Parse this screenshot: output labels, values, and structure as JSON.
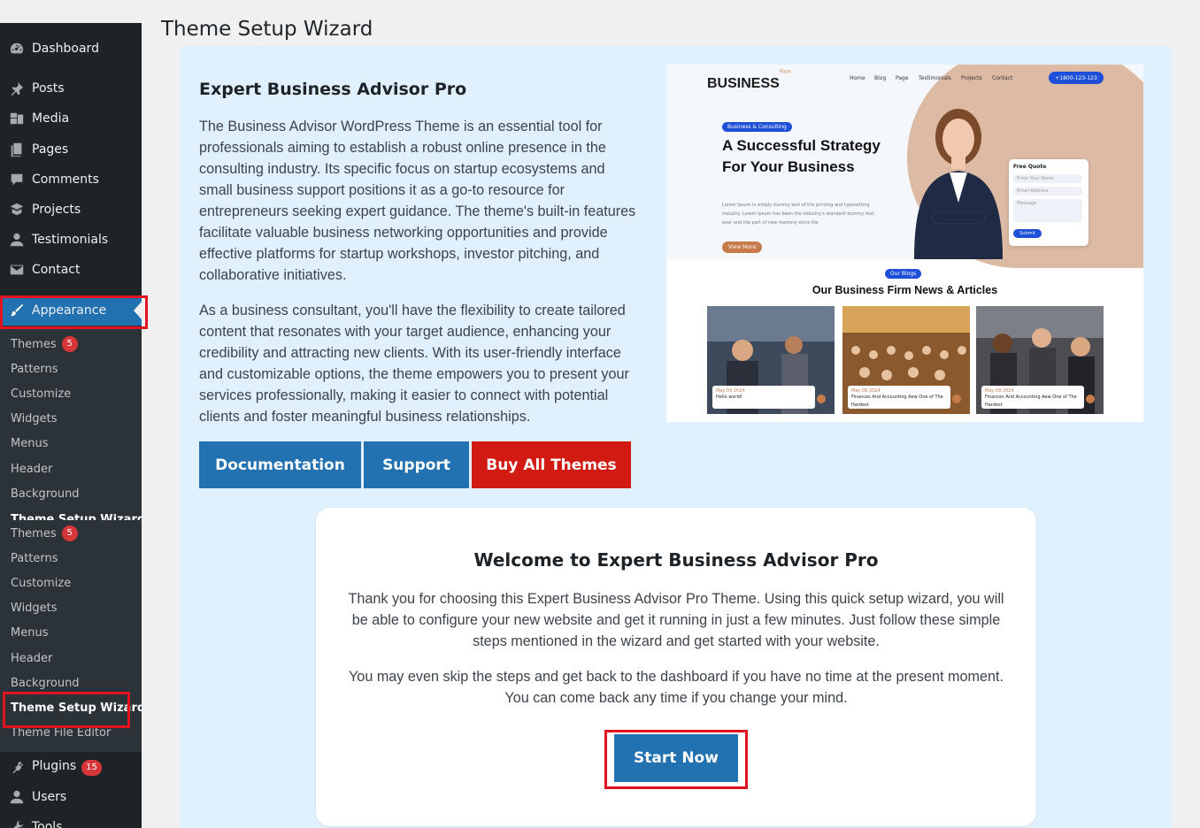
{
  "page": {
    "title": "Theme Setup Wizard"
  },
  "sidebar": {
    "top_items": [
      {
        "label": "Dashboard",
        "icon": "dashboard-icon"
      },
      {
        "label": "Posts",
        "icon": "pin-icon"
      },
      {
        "label": "Media",
        "icon": "media-icon"
      },
      {
        "label": "Pages",
        "icon": "pages-icon"
      },
      {
        "label": "Comments",
        "icon": "comment-icon"
      },
      {
        "label": "Projects",
        "icon": "portfolio-icon"
      },
      {
        "label": "Testimonials",
        "icon": "user-icon"
      },
      {
        "label": "Contact",
        "icon": "mail-icon"
      }
    ],
    "appearance": {
      "label": "Appearance",
      "icon": "paintbrush-icon"
    },
    "submenu": [
      {
        "label": "Themes",
        "badge": "5"
      },
      {
        "label": "Patterns"
      },
      {
        "label": "Customize"
      },
      {
        "label": "Widgets"
      },
      {
        "label": "Menus"
      },
      {
        "label": "Header"
      },
      {
        "label": "Background"
      },
      {
        "label": "Theme Setup Wizard"
      },
      {
        "label": "Themes",
        "badge": "5"
      },
      {
        "label": "Patterns"
      },
      {
        "label": "Customize"
      },
      {
        "label": "Widgets"
      },
      {
        "label": "Menus"
      },
      {
        "label": "Header"
      },
      {
        "label": "Background"
      },
      {
        "label": "Theme Setup Wizard"
      },
      {
        "label": "Theme File Editor"
      }
    ],
    "bottom_items": [
      {
        "label": "Plugins",
        "badge": "15",
        "icon": "plugin-icon"
      },
      {
        "label": "Users",
        "icon": "users-icon"
      },
      {
        "label": "Tools",
        "icon": "tools-icon"
      }
    ]
  },
  "intro": {
    "title": "Expert Business Advisor Pro",
    "paragraph1": "The Business Advisor WordPress Theme is an essential tool for professionals aiming to establish a robust online presence in the consulting industry. Its specific focus on startup ecosystems and small business support positions it as a go-to resource for entrepreneurs seeking expert guidance. The theme's built-in features facilitate valuable business networking opportunities and provide effective platforms for startup workshops, investor pitching, and collaborative initiatives.",
    "paragraph2": "As a business consultant, you'll have the flexibility to create tailored content that resonates with your target audience, enhancing your credibility and attracting new clients. With its user-friendly interface and customizable options, the theme empowers you to present your services professionally, making it easier to connect with potential clients and foster meaningful business relationships.",
    "buttons": {
      "documentation": "Documentation",
      "support": "Support",
      "buy": "Buy All Themes"
    }
  },
  "preview": {
    "logo": "BUSINESS",
    "logo_small": "Firm",
    "nav": [
      "Home",
      "Blog",
      "Page",
      "Testimonials",
      "Projects",
      "Contact"
    ],
    "phone": "+1800-123-123",
    "tag": "Business & Consulting",
    "hero_title": "A Successful Strategy For Your Business",
    "hero_text": "Lorem Ipsum is simply dummy text of the printing and typesetting industry. Lorem Ipsum has been the industry's standard dummy text ever and the part of new memory since the",
    "view_more": "View More",
    "quote": {
      "title": "Free Quote",
      "name": "Enter Your Name",
      "email": "Email Address",
      "message": "Message",
      "submit": "Submit"
    },
    "blog_tag": "Our Blogs",
    "blog_title": "Our Business Firm News & Articles",
    "cards": [
      {
        "date": "May 09 2024",
        "title": "Hello world!"
      },
      {
        "date": "May 09 2024",
        "title": "Finances And Accounting Aew One of The Hardest"
      },
      {
        "date": "May 09 2024",
        "title": "Finances And Accounting Aew One of The Hardest"
      }
    ]
  },
  "welcome": {
    "title": "Welcome to Expert Business Advisor Pro",
    "text1": "Thank you for choosing this Expert Business Advisor Pro Theme. Using this quick setup wizard, you will be able to configure your new website and get it running in just a few minutes. Just follow these simple steps mentioned in the wizard and get started with your website.",
    "text2": "You may even skip the steps and get back to the dashboard if you have no time at the present moment. You can come back any time if you change your mind.",
    "start_button": "Start Now"
  },
  "colors": {
    "sidebar_bg": "#1d2327",
    "submenu_bg": "#2c3338",
    "accent": "#2271b1",
    "buy_button": "#d11a12",
    "highlight": "#e0131f",
    "panel_bg": "#e1f0fd"
  }
}
